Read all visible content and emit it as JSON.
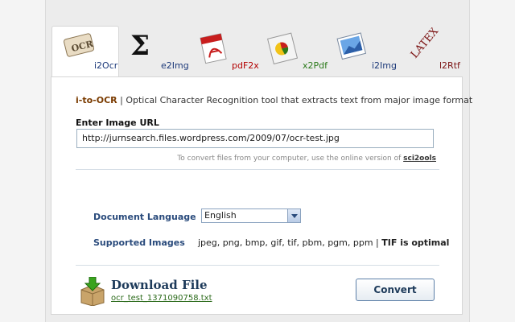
{
  "tabs": [
    {
      "label": "i2Ocr",
      "color": "#1d3a7a",
      "active": true
    },
    {
      "label": "e2Img",
      "color": "#1d3a7a"
    },
    {
      "label": "pdF2x",
      "color": "#b30000"
    },
    {
      "label": "x2Pdf",
      "color": "#2b7a1a"
    },
    {
      "label": "i2Img",
      "color": "#1d3a7a"
    },
    {
      "label": "l2Rtf",
      "color": "#7a1010"
    }
  ],
  "icons": {
    "ocr": "OCR",
    "latex": "LATEX"
  },
  "description": {
    "brand": "i-to-OCR",
    "separator": " | ",
    "text": "Optical Character Recognition tool that extracts text from major image format"
  },
  "url_field": {
    "label": "Enter Image URL",
    "value": "http://jurnsearch.files.wordpress.com/2009/07/ocr-test.jpg"
  },
  "hint": {
    "text": "To convert files from your computer, use the online version of ",
    "link": "sci2ools"
  },
  "language": {
    "label": "Document Language",
    "selected": "English"
  },
  "images": {
    "label": "Supported Images",
    "formats": "jpeg, png, bmp, gif, tif, pbm, pgm, ppm | ",
    "optimal": "TIF is optimal"
  },
  "download": {
    "title": "Download File",
    "filename": "ocr_test_1371090758.txt"
  },
  "convert_button": "Convert"
}
